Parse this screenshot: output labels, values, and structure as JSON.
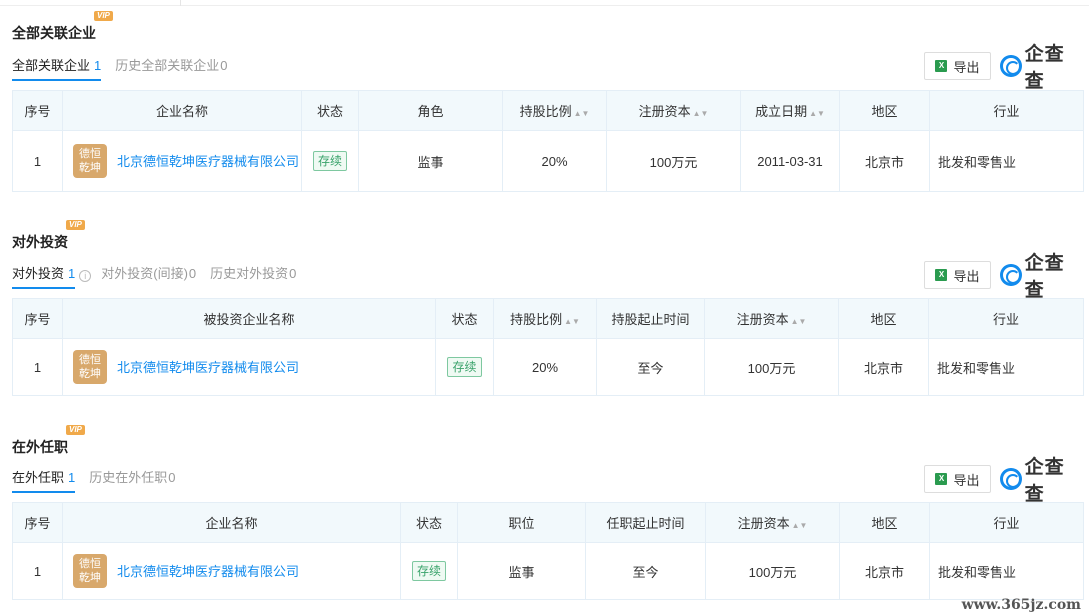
{
  "vip_badge": "VIP",
  "export_label": "导出",
  "xls_glyph": "X",
  "brand_name": "企查查",
  "company_logo": [
    "德恒",
    "乾坤"
  ],
  "section1": {
    "title": "全部关联企业",
    "tabs": [
      {
        "label": "全部关联企业",
        "count": "1",
        "active": true
      },
      {
        "label": "历史全部关联企业",
        "count": "0",
        "active": false
      }
    ],
    "headers": [
      "序号",
      "企业名称",
      "状态",
      "角色",
      "持股比例",
      "注册资本",
      "成立日期",
      "地区",
      "行业"
    ],
    "rows": [
      {
        "index": "1",
        "name": "北京德恒乾坤医疗器械有限公司",
        "status": "存续",
        "role": "监事",
        "share": "20%",
        "capital": "100万元",
        "date": "2011-03-31",
        "region": "北京市",
        "industry": "批发和零售业"
      }
    ]
  },
  "section2": {
    "title": "对外投资",
    "tabs": [
      {
        "label": "对外投资",
        "count": "1",
        "active": true
      },
      {
        "label": "对外投资(间接)",
        "count": "0",
        "active": false
      },
      {
        "label": "历史对外投资",
        "count": "0",
        "active": false
      }
    ],
    "info_glyph": "i",
    "headers": [
      "序号",
      "被投资企业名称",
      "状态",
      "持股比例",
      "持股起止时间",
      "注册资本",
      "地区",
      "行业"
    ],
    "rows": [
      {
        "index": "1",
        "name": "北京德恒乾坤医疗器械有限公司",
        "status": "存续",
        "share": "20%",
        "period": "至今",
        "capital": "100万元",
        "region": "北京市",
        "industry": "批发和零售业"
      }
    ]
  },
  "section3": {
    "title": "在外任职",
    "tabs": [
      {
        "label": "在外任职",
        "count": "1",
        "active": true
      },
      {
        "label": "历史在外任职",
        "count": "0",
        "active": false
      }
    ],
    "headers": [
      "序号",
      "企业名称",
      "状态",
      "职位",
      "任职起止时间",
      "注册资本",
      "地区",
      "行业"
    ],
    "rows": [
      {
        "index": "1",
        "name": "北京德恒乾坤医疗器械有限公司",
        "status": "存续",
        "position": "监事",
        "period": "至今",
        "capital": "100万元",
        "region": "北京市",
        "industry": "批发和零售业"
      }
    ]
  },
  "watermark": "www.365jz.com"
}
